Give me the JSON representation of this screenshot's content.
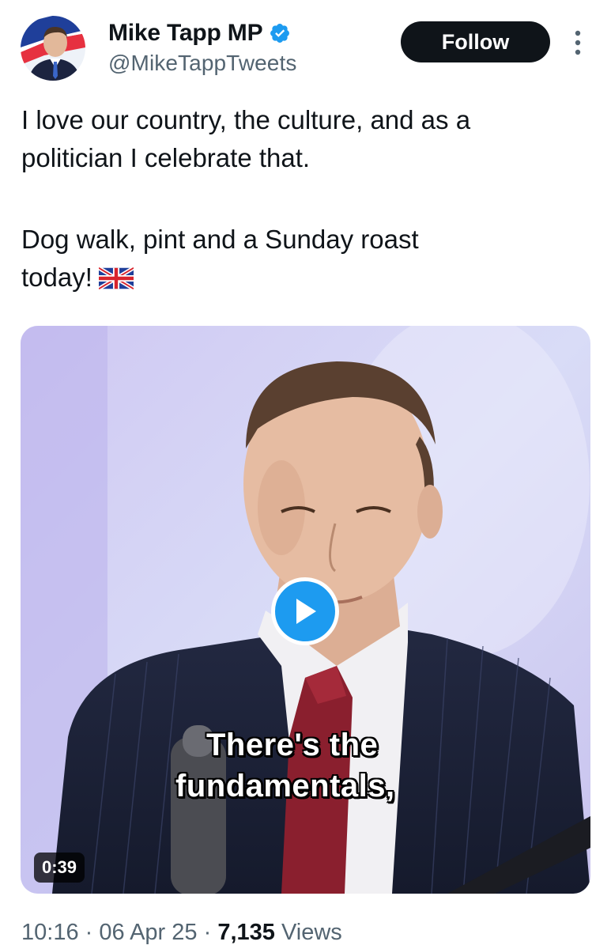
{
  "author": {
    "display_name": "Mike Tapp MP",
    "handle": "@MikeTappTweets",
    "verified_color": "#1d9bf0"
  },
  "follow_button": {
    "label": "Follow"
  },
  "more_menu": {
    "icon": "more-vertical-icon"
  },
  "tweet": {
    "line1": "I love our country, the culture, and as a",
    "line2": "politician I celebrate that.",
    "line3": "Dog walk, pint and a Sunday roast",
    "line4": "today!",
    "emoji": "uk-flag-emoji"
  },
  "video": {
    "caption_line1": "There's the",
    "caption_line2": "fundamentals,",
    "duration": "0:39",
    "play_icon": "play-icon"
  },
  "meta": {
    "time": "10:16",
    "separator": "·",
    "date": "06 Apr 25",
    "views_count": "7,135",
    "views_label": "Views"
  },
  "colors": {
    "text_primary": "#0f1419",
    "text_secondary": "#536471",
    "accent": "#1d9bf0",
    "follow_bg": "#0f1419"
  }
}
